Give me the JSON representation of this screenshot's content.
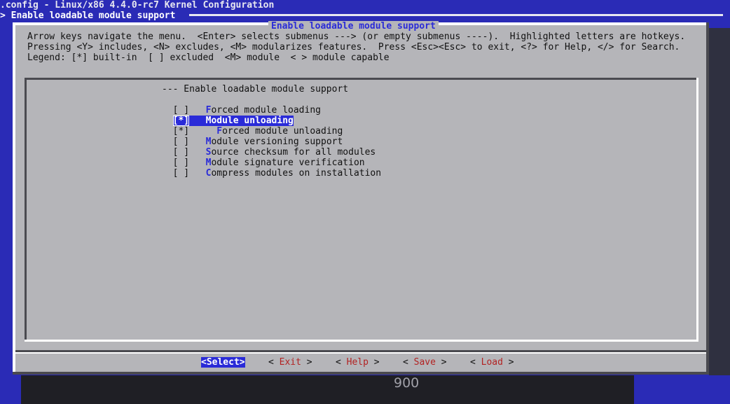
{
  "window": {
    "title": ".config - Linux/x86 4.4.0-rc7 Kernel Configuration",
    "breadcrumb": "> Enable loadable module support"
  },
  "background": {
    "peek_text": "900"
  },
  "dialog": {
    "title": "Enable loadable module support",
    "help_lines": [
      "Arrow keys navigate the menu.  <Enter> selects submenus ---> (or empty submenus ----).  Highlighted letters are hotkeys.",
      "Pressing <Y> includes, <N> excludes, <M> modularizes features.  Press <Esc><Esc> to exit, <?> for Help, </> for Search.",
      "Legend: [*] built-in  [ ] excluded  <M> module  < > module capable"
    ]
  },
  "menu": {
    "header": "--- Enable loadable module support",
    "items": [
      {
        "state": "[ ]",
        "indent": "   ",
        "hotkey": "F",
        "rest": "orced module loading",
        "selected": false
      },
      {
        "state": "[*]",
        "indent": "   ",
        "hotkey": "M",
        "rest": "odule unloading",
        "selected": true
      },
      {
        "state": "[*]",
        "indent": "     ",
        "hotkey": "F",
        "rest": "orced module unloading",
        "selected": false
      },
      {
        "state": "[ ]",
        "indent": "   ",
        "hotkey": "M",
        "rest": "odule versioning support",
        "selected": false
      },
      {
        "state": "[ ]",
        "indent": "   ",
        "hotkey": "S",
        "rest": "ource checksum for all modules",
        "selected": false
      },
      {
        "state": "[ ]",
        "indent": "   ",
        "hotkey": "M",
        "rest": "odule signature verification",
        "selected": false
      },
      {
        "state": "[ ]",
        "indent": "   ",
        "hotkey": "C",
        "rest": "ompress modules on installation",
        "selected": false
      }
    ]
  },
  "buttons": [
    {
      "label": "<Select>",
      "open": "<",
      "hotkey": "S",
      "rest": "elect",
      "close": ">",
      "selected": true
    },
    {
      "label": "< Exit >",
      "open": "< ",
      "hotkey": "E",
      "rest": "xit",
      "close": " >",
      "selected": false
    },
    {
      "label": "< Help >",
      "open": "< ",
      "hotkey": "H",
      "rest": "elp",
      "close": " >",
      "selected": false
    },
    {
      "label": "< Save >",
      "open": "< ",
      "hotkey": "S",
      "rest": "ave",
      "close": " >",
      "selected": false
    },
    {
      "label": "< Load >",
      "open": "< ",
      "hotkey": "L",
      "rest": "oad",
      "close": " >",
      "selected": false
    }
  ]
}
